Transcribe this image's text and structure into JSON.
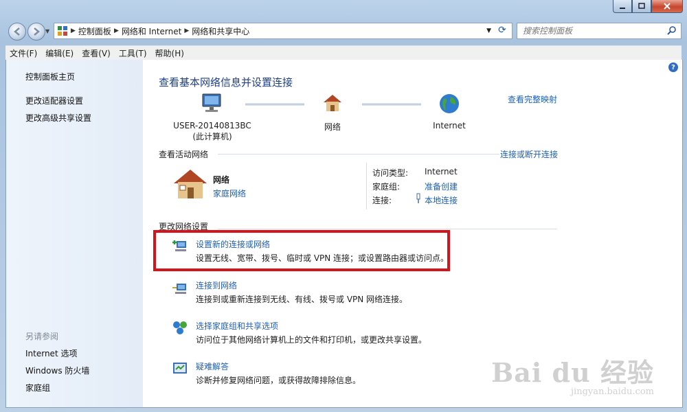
{
  "address": {
    "crumbs": [
      "控制面板",
      "网络和 Internet",
      "网络和共享中心"
    ]
  },
  "search": {
    "placeholder": "搜索控制面板"
  },
  "menu": [
    "文件(F)",
    "编辑(E)",
    "查看(V)",
    "工具(T)",
    "帮助(H)"
  ],
  "sidebar": {
    "links": [
      "控制面板主页",
      "更改适配器设置",
      "更改高级共享设置"
    ],
    "see_also_heading": "另请参阅",
    "see_also": [
      "Internet 选项",
      "Windows 防火墙",
      "家庭组"
    ]
  },
  "main": {
    "title": "查看基本网络信息并设置连接",
    "full_map_link": "查看完整映射",
    "map": {
      "computer_name": "USER-20140813BC",
      "computer_sub": "(此计算机)",
      "network": "网络",
      "internet": "Internet"
    },
    "active_heading": "查看活动网络",
    "connect_disconnect_link": "连接或断开连接",
    "active": {
      "name": "网络",
      "type_link": "家庭网络",
      "access_type_label": "访问类型:",
      "access_type_value": "Internet",
      "homegroup_label": "家庭组:",
      "homegroup_link": "准备创建",
      "connections_label": "连接:",
      "connections_link": "本地连接"
    },
    "change_heading": "更改网络设置",
    "tasks": [
      {
        "title": "设置新的连接或网络",
        "desc": "设置无线、宽带、拨号、临时或 VPN 连接；或设置路由器或访问点。"
      },
      {
        "title": "连接到网络",
        "desc": "连接到或重新连接到无线、有线、拨号或 VPN 网络连接。"
      },
      {
        "title": "选择家庭组和共享选项",
        "desc": "访问位于其他网络计算机上的文件和打印机，或更改共享设置。"
      },
      {
        "title": "疑难解答",
        "desc": "诊断并修复网络问题，或获得故障排除信息。"
      }
    ]
  },
  "watermark": {
    "brand": "Bai du 经验",
    "url": "jingyan.baidu.com"
  },
  "colors": {
    "link": "#1f5fb5",
    "title": "#1e3f8a",
    "highlight": "#d4141a"
  }
}
